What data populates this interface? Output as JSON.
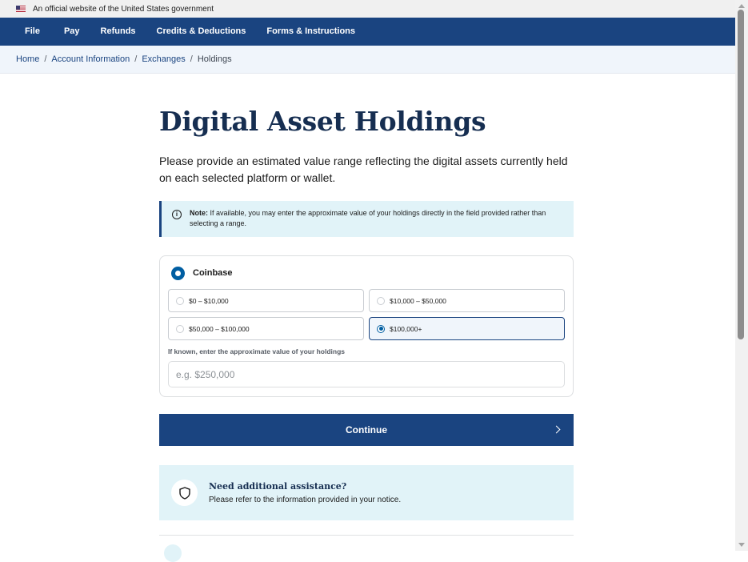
{
  "gov_banner": {
    "text": "An official website of the United States government"
  },
  "nav": {
    "items": [
      "File",
      "Pay",
      "Refunds",
      "Credits & Deductions",
      "Forms & Instructions"
    ]
  },
  "breadcrumb": {
    "home": "Home",
    "account": "Account Information",
    "exchanges": "Exchanges",
    "current": "Holdings",
    "separator": "/"
  },
  "page": {
    "title": "Digital Asset Holdings",
    "intro": "Please provide an estimated value range reflecting the digital assets currently held on each selected platform or wallet."
  },
  "note": {
    "label": "Note:",
    "text": "If available, you may enter the approximate value of your holdings directly in the field provided rather than selecting a range."
  },
  "platform": {
    "name": "Coinbase",
    "ranges": [
      "$0 – $10,000",
      "$10,000 – $50,000",
      "$50,000 – $100,000",
      "$100,000+"
    ],
    "selected": "$100,000+",
    "holdings_label": "If known, enter the approximate value of your holdings",
    "holdings_placeholder": "e.g. $250,000"
  },
  "continue": {
    "label": "Continue"
  },
  "assist": {
    "title": "Need additional assistance?",
    "text": "Please refer to the information provided in your notice."
  },
  "icons": {
    "flag": "us-flag-icon",
    "info": "info-icon",
    "chevron": "chevron-right-icon",
    "shield": "shield-icon"
  },
  "colors": {
    "primary": "#1a4480",
    "title": "#162e51",
    "info_bg": "#e1f3f8",
    "breadcrumb_bg": "#f0f5fb"
  }
}
